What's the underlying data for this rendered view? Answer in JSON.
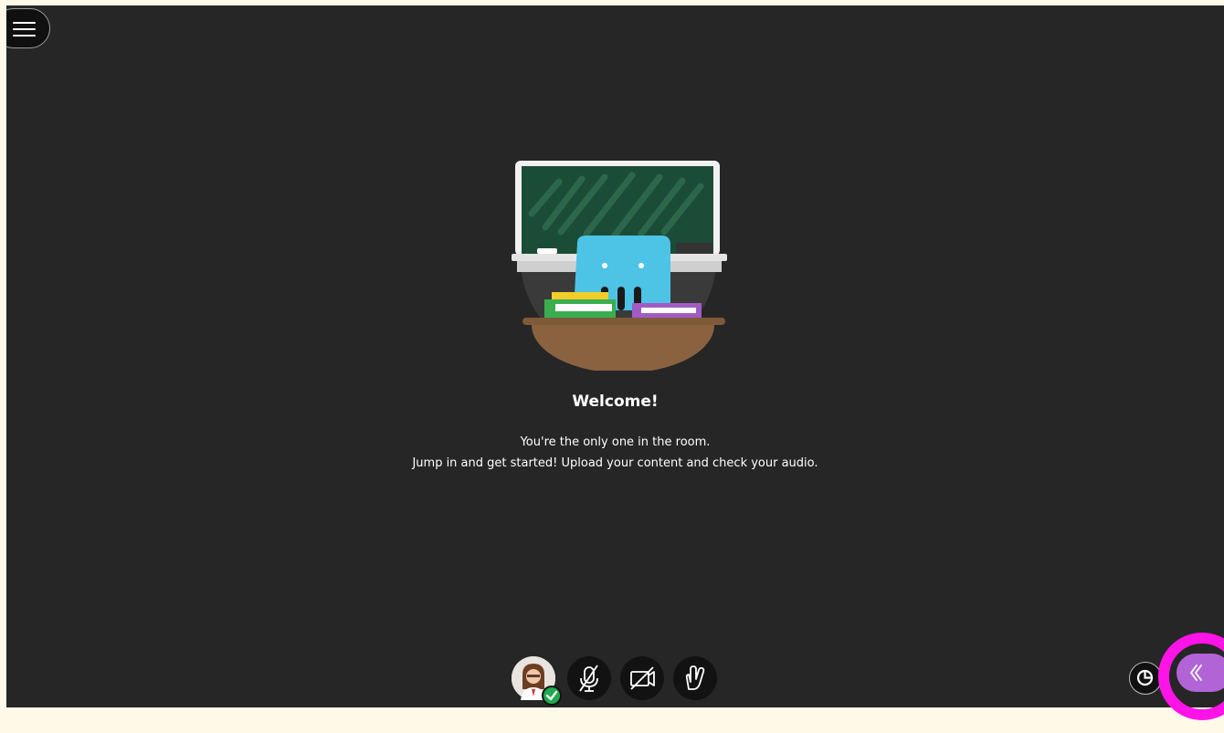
{
  "header": {
    "menu_icon": "hamburger-menu-icon"
  },
  "welcome": {
    "title": "Welcome!",
    "line1": "You're the only one in the room.",
    "line2": "Jump in and get started! Upload your content and check your audio."
  },
  "controls": {
    "avatar_icon": "user-avatar",
    "status_icon": "checkmark-icon",
    "mic_icon": "microphone-muted-icon",
    "camera_icon": "camera-off-icon",
    "hand_icon": "raise-hand-icon"
  },
  "corner": {
    "rating_icon": "session-feedback-icon",
    "panel_icon": "double-chevron-left-icon"
  },
  "colors": {
    "background": "#262626",
    "page_bg": "#fff9e8",
    "panel_button": "#b264d6",
    "highlight": "#ff14e8",
    "status_ok": "#1faa4f"
  }
}
